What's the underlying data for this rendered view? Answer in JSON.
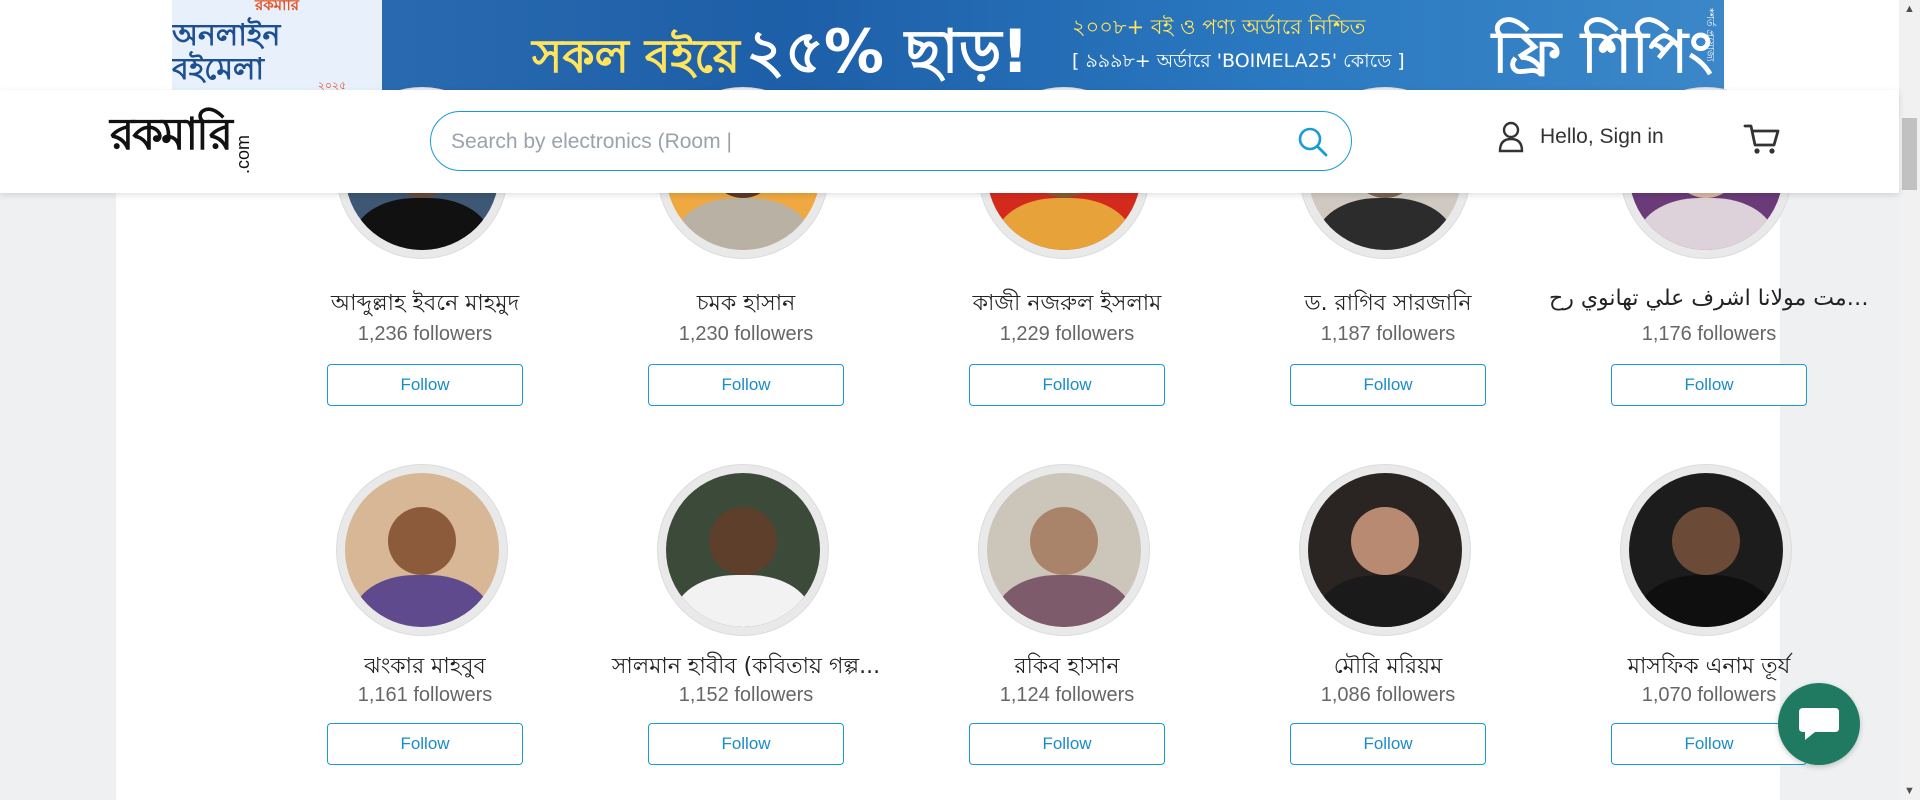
{
  "banner": {
    "logo_top": "রকমারি",
    "logo_main": "অনলাইন বইমেলা",
    "logo_year": "২০২৫",
    "headline": "সকল বইয়ে",
    "discount": "২৫% ছাড়!",
    "line1": "২০০৮+ বই ও পণ্য অর্ডারে নিশ্চিত",
    "line2": "[ ৯৯৯৮+ অর্ডারে 'BOIMELA25' কোডে ]",
    "shipping": "ফ্রি শিপিং",
    "conditions": "*শর্ত প্রযোজ্য"
  },
  "header": {
    "logo_text": "রকমারি",
    "logo_suffix": ".com",
    "search_placeholder": "Search by electronics (Room |",
    "signin_label": "Hello, Sign in"
  },
  "authors": [
    {
      "name": "আব্দুল্লাহ ইবনে মাহমুদ",
      "followers": "1,236 followers",
      "follow_label": "Follow"
    },
    {
      "name": "চমক হাসান",
      "followers": "1,230 followers",
      "follow_label": "Follow"
    },
    {
      "name": "কাজী নজরুল ইসলাম",
      "followers": "1,229 followers",
      "follow_label": "Follow"
    },
    {
      "name": "ড. রাগিব সারজানি",
      "followers": "1,187 followers",
      "follow_label": "Follow"
    },
    {
      "name": "الامت مولانا اشرف علي تهانوي رح...",
      "followers": "1,176 followers",
      "follow_label": "Follow"
    },
    {
      "name": "ঝংকার মাহবুব",
      "followers": "1,161 followers",
      "follow_label": "Follow"
    },
    {
      "name": "সালমান হাবীব (কবিতায় গল্প...",
      "followers": "1,152 followers",
      "follow_label": "Follow"
    },
    {
      "name": "রকিব হাসান",
      "followers": "1,124 followers",
      "follow_label": "Follow"
    },
    {
      "name": "মৌরি মরিয়ম",
      "followers": "1,086 followers",
      "follow_label": "Follow"
    },
    {
      "name": "মাসফিক এনাম তূর্য",
      "followers": "1,070 followers",
      "follow_label": "Follow"
    }
  ],
  "colors": {
    "accent": "#1a9bd7",
    "chat": "#1f7a61",
    "banner": "#1d5fa8"
  }
}
